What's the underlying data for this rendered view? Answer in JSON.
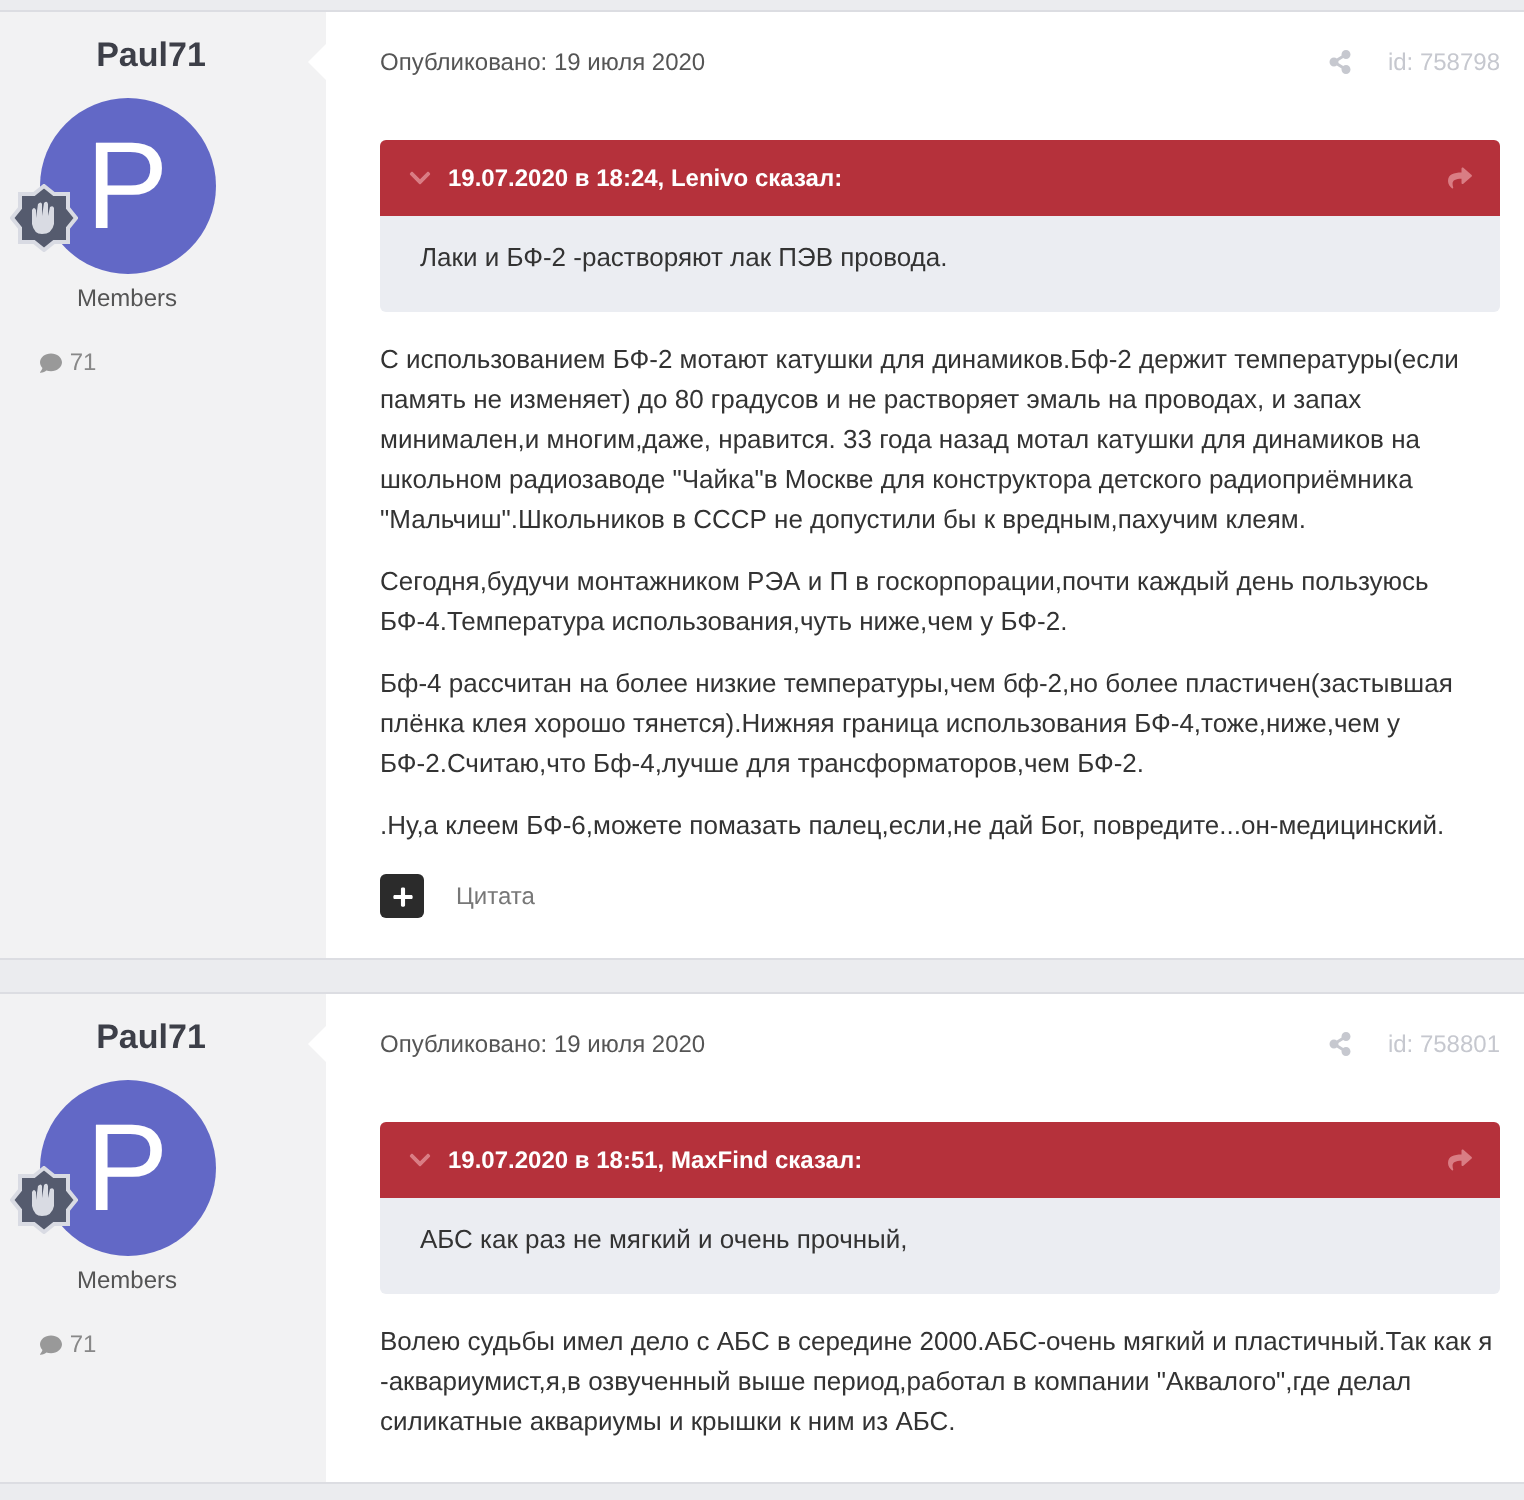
{
  "posts": [
    {
      "author": "Paul71",
      "avatar_letter": "P",
      "group": "Members",
      "post_count": "71",
      "published": "Опубликовано: 19 июля 2020",
      "post_id": "id: 758798",
      "quote": {
        "header": "19.07.2020 в 18:24, Lenivo сказал:",
        "text": "Лаки и БФ-2 -растворяют лак ПЭВ провода."
      },
      "paragraphs": [
        "С использованием БФ-2 мотают катушки для динамиков.Бф-2 держит температуры(если память не изменяет) до 80 градусов и не растворяет эмаль на проводах, и запах минимален,и многим,даже, нравится. 33 года назад мотал катушки для динамиков на школьном радиозаводе \"Чайка\"в Москве для конструктора детского радиоприёмника \"Мальчиш\".Школьников в СССР не допустили бы  к вредным,пахучим клеям.",
        "Сегодня,будучи монтажником РЭА и П в госкорпорации,почти каждый день пользуюсь БФ-4.Температура использования,чуть ниже,чем у БФ-2.",
        "Бф-4 рассчитан на более низкие температуры,чем бф-2,но более пластичен(застывшая плёнка клея хорошо тянется).Нижняя граница использования БФ-4,тоже,ниже,чем у БФ-2.Считаю,что Бф-4,лучше для трансформаторов,чем БФ-2.",
        ".Ну,а клеем БФ-6,можете помазать палец,если,не дай Бог, повредите...он-медицинский."
      ],
      "quote_link": "Цитата"
    },
    {
      "author": "Paul71",
      "avatar_letter": "P",
      "group": "Members",
      "post_count": "71",
      "published": "Опубликовано: 19 июля 2020",
      "post_id": "id: 758801",
      "quote": {
        "header": "19.07.2020 в 18:51, MaxFind сказал:",
        "text": "АБС как раз не мягкий и очень прочный,"
      },
      "paragraphs": [
        " Волею судьбы имел дело с АБС в середине 2000.АБС-очень мягкий и пластичный.Так как я -аквариумист,я,в озвученный выше период,работал в компании \"Аквалого\",где делал силикатные аквариумы и крышки к ним из АБС."
      ]
    }
  ]
}
